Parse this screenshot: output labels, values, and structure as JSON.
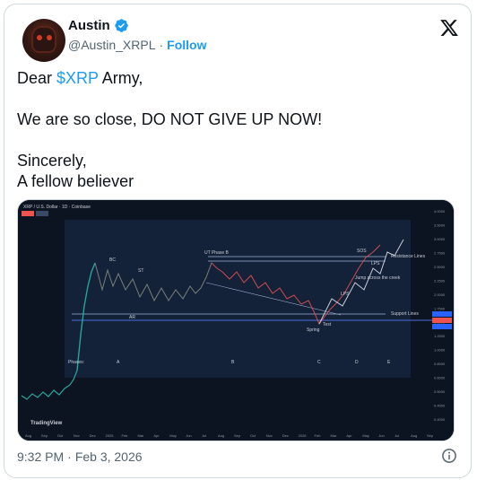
{
  "author": {
    "name": "Austin",
    "handle": "@Austin_XRPL",
    "separator": "·",
    "follow_label": "Follow",
    "verified_icon": "verified-badge-icon",
    "platform_icon": "x-logo-icon"
  },
  "tweet": {
    "line1_prefix": "Dear ",
    "cashtag": "$XRP",
    "line1_suffix": " Army,",
    "line2": "We are so close, DO NOT GIVE UP NOW!",
    "line3": "Sincerely,",
    "line4": "A fellow believer"
  },
  "footer": {
    "time": "9:32 PM",
    "separator": "·",
    "date": "Feb 3, 2026",
    "info_icon": "info-icon"
  },
  "colors": {
    "accent": "#1d9bf0",
    "chart_bg": "#0d1421",
    "candle_up": "#26a69a",
    "candle_down": "#ef5350"
  },
  "media": {
    "header": "XRP / U.S. Dollar · 1D · Coinbase",
    "watermark": "TradingView",
    "annotations": {
      "ut_phase_b": "UT Phase B",
      "bc": "BC",
      "st": "ST",
      "ar": "AR",
      "sos": "SOS",
      "lps_top": "LPS",
      "lps_mid": "LPS",
      "resistance": "Resistance\nLines",
      "jump": "Jump\nacross\nthe creek",
      "support": "Support\nLines",
      "test": "Test",
      "spring": "Spring",
      "phases": "Phases:",
      "phase_a": "A",
      "phase_b": "B",
      "phase_c": "C",
      "phase_d": "D",
      "phase_e": "E"
    },
    "price_scale": [
      "4.0000",
      "3.5000",
      "3.0000",
      "2.7500",
      "2.5000",
      "2.2500",
      "2.0000",
      "1.7500",
      "1.5000",
      "1.2500",
      "1.0000",
      "0.8000",
      "0.6000",
      "0.5000",
      "0.4500",
      "0.4000"
    ],
    "time_axis": [
      "Aug",
      "Sep",
      "Oct",
      "Nov",
      "Dec",
      "2025",
      "Feb",
      "Mar",
      "Apr",
      "May",
      "Jun",
      "Jul",
      "Aug",
      "Sep",
      "Oct",
      "Nov",
      "Dec",
      "2026",
      "Feb",
      "Mar",
      "Apr",
      "May",
      "Jun",
      "Jul",
      "Aug",
      "Sep"
    ]
  }
}
